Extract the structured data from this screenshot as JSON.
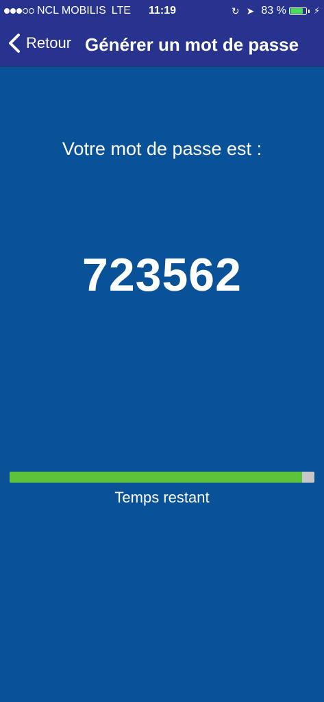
{
  "status_bar": {
    "signal_bars_filled": 3,
    "signal_bars_total": 5,
    "carrier": "NCL MOBILIS",
    "network": "LTE",
    "time": "11:19",
    "battery_percent_text": "83 %",
    "battery_level": 0.83,
    "icons": [
      "lock-rotation-icon",
      "location-icon",
      "battery-icon",
      "charging-icon"
    ]
  },
  "navbar": {
    "back_label": "Retour",
    "title": "Générer un mot de passe"
  },
  "main": {
    "prompt": "Votre mot de passe est :",
    "password": "723562",
    "progress_remaining": 0.96,
    "progress_label": "Temps restant"
  },
  "colors": {
    "background": "#0a5298",
    "navbar": "#27338d",
    "progress_fill": "#5ec33a",
    "progress_track": "#c7c7c7",
    "text": "#ffffff"
  }
}
